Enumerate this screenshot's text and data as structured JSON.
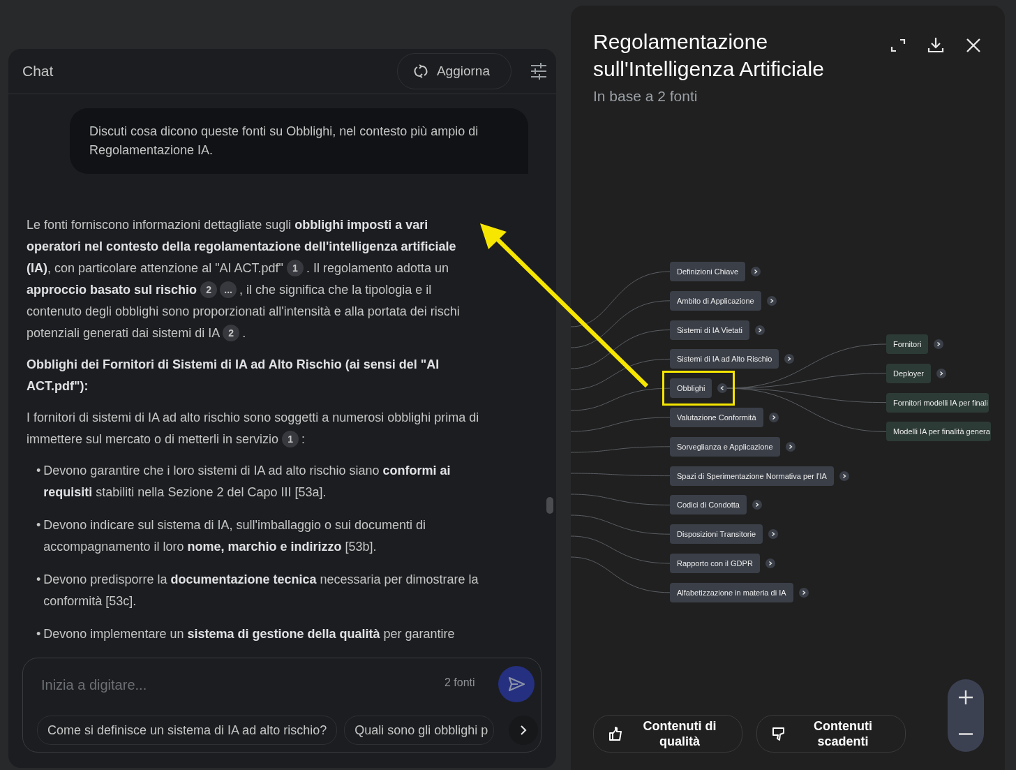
{
  "chat": {
    "title": "Chat",
    "refresh_button": "Aggiorna",
    "user_message": "Discuti cosa dicono queste fonti su Obblighi, nel contesto più ampio di Regolamentazione IA.",
    "answer": [
      {
        "kind": "paragraph",
        "segments": [
          {
            "text": "Le fonti forniscono informazioni dettagliate sugli **obblighi imposti a vari operatori nel contesto della regolamentazione dell'intelligenza artificiale (IA)**, con particolare attenzione al \"AI ACT.pdf\" "
          },
          {
            "cite": "1"
          },
          {
            "text": ". Il regolamento adotta un **approccio basato sul rischio** "
          },
          {
            "cite": "2"
          },
          {
            "cite": "..."
          },
          {
            "text": ", il che significa che la tipologia e il contenuto degli obblighi sono proporzionati all'intensità e alla portata dei rischi potenziali generati dai sistemi di IA "
          },
          {
            "cite": "2"
          },
          {
            "text": "."
          }
        ]
      },
      {
        "kind": "heading",
        "text": "Obblighi dei Fornitori di Sistemi di IA ad Alto Rischio (ai sensi del \"AI ACT.pdf\"):"
      },
      {
        "kind": "paragraph",
        "segments": [
          {
            "text": "I fornitori di sistemi di IA ad alto rischio sono soggetti a numerosi obblighi prima di immettere sul mercato o di metterli in servizio "
          },
          {
            "cite": "1"
          },
          {
            "text": ":"
          }
        ]
      },
      {
        "kind": "bullet",
        "marker": "•",
        "segments": [
          {
            "text": "Devono garantire che i loro sistemi di IA ad alto rischio siano **conformi ai requisiti** stabiliti nella Sezione 2 del Capo III [53a]."
          }
        ]
      },
      {
        "kind": "bullet",
        "marker": "•",
        "segments": [
          {
            "text": "Devono indicare sul sistema di IA, sull'imballaggio o sui documenti di accompagnamento il loro **nome, marchio e indirizzo** [53b]."
          }
        ]
      },
      {
        "kind": "bullet",
        "marker": "•",
        "segments": [
          {
            "text": "Devono predisporre la **documentazione tecnica** necessaria per dimostrare la conformità [53c]."
          }
        ]
      },
      {
        "kind": "bullet",
        "marker": "•",
        "segments": [
          {
            "text": "Devono implementare un **sistema di gestione della qualità** per garantire"
          }
        ]
      }
    ],
    "input": {
      "placeholder": "Inizia a digitare...",
      "source_count": "2 fonti"
    },
    "suggestions": [
      "Come si definisce un sistema di IA ad alto rischio?",
      "Quali sono gli obblighi p"
    ]
  },
  "mind_map": {
    "title": "Regolamentazione sull'Intelligenza Artificiale",
    "subtitle": "In base a 2 fonti",
    "nodes": [
      {
        "label": "Definizioni Chiave",
        "expanded": false,
        "highlighted": false
      },
      {
        "label": "Ambito di Applicazione",
        "expanded": false,
        "highlighted": false
      },
      {
        "label": "Sistemi di IA Vietati",
        "expanded": false,
        "highlighted": false
      },
      {
        "label": "Sistemi di IA ad Alto Rischio",
        "expanded": false,
        "highlighted": false
      },
      {
        "label": "Obblighi",
        "expanded": true,
        "highlighted": true,
        "children": [
          {
            "label": "Fornitori",
            "expanded": false
          },
          {
            "label": "Deployer",
            "expanded": false
          },
          {
            "label": "Fornitori modelli IA per finali"
          },
          {
            "label": "Modelli IA per finalità genera"
          }
        ]
      },
      {
        "label": "Valutazione Conformità",
        "expanded": false,
        "highlighted": false
      },
      {
        "label": "Sorveglianza e Applicazione",
        "expanded": false,
        "highlighted": false
      },
      {
        "label": "Spazi di Sperimentazione Normativa per l'IA",
        "expanded": false,
        "highlighted": false
      },
      {
        "label": "Codici di Condotta",
        "expanded": false,
        "highlighted": false
      },
      {
        "label": "Disposizioni Transitorie",
        "expanded": false,
        "highlighted": false
      },
      {
        "label": "Rapporto con il GDPR",
        "expanded": false,
        "highlighted": false
      },
      {
        "label": "Alfabetizzazione in materia di IA",
        "expanded": false,
        "highlighted": false
      }
    ],
    "feedback_buttons": [
      {
        "kind": "good",
        "label": "Contenuti di qualità"
      },
      {
        "kind": "bad",
        "label": "Contenuti scadenti"
      }
    ]
  },
  "annotation": {
    "kind": "arrow"
  }
}
